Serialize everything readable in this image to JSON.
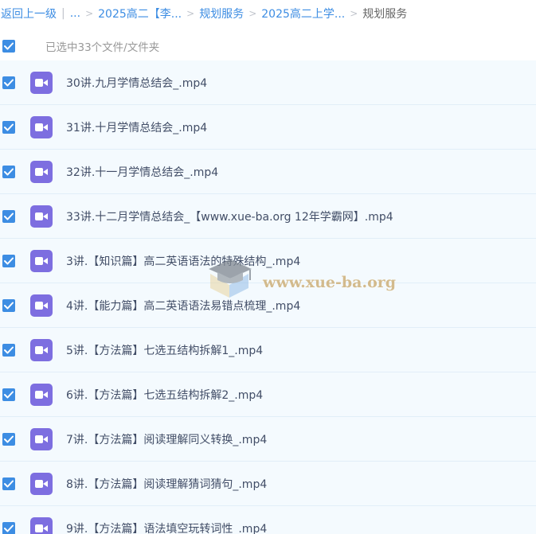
{
  "breadcrumb": {
    "back_label": "返回上一级",
    "divider": "|",
    "ellipsis": "...",
    "sep": ">",
    "items": [
      "2025高二【李...",
      "规划服务",
      "2025高二上学..."
    ],
    "current": "规划服务"
  },
  "selection": {
    "checked": true,
    "text": "已选中33个文件/文件夹"
  },
  "files": [
    {
      "name": "30讲.九月学情总结会_.mp4",
      "checked": true,
      "icon": "video-icon"
    },
    {
      "name": "31讲.十月学情总结会_.mp4",
      "checked": true,
      "icon": "video-icon"
    },
    {
      "name": "32讲.十一月学情总结会_.mp4",
      "checked": true,
      "icon": "video-icon"
    },
    {
      "name": "33讲.十二月学情总结会_【www.xue-ba.org 12年学霸网】.mp4",
      "checked": true,
      "icon": "video-icon"
    },
    {
      "name": "3讲.【知识篇】高二英语语法的特殊结构_.mp4",
      "checked": true,
      "icon": "video-icon"
    },
    {
      "name": "4讲.【能力篇】高二英语语法易错点梳理_.mp4",
      "checked": true,
      "icon": "video-icon"
    },
    {
      "name": "5讲.【方法篇】七选五结构拆解1_.mp4",
      "checked": true,
      "icon": "video-icon"
    },
    {
      "name": "6讲.【方法篇】七选五结构拆解2_.mp4",
      "checked": true,
      "icon": "video-icon"
    },
    {
      "name": "7讲.【方法篇】阅读理解同义转换_.mp4",
      "checked": true,
      "icon": "video-icon"
    },
    {
      "name": "8讲.【方法篇】阅读理解猜词猜句_.mp4",
      "checked": true,
      "icon": "video-icon"
    },
    {
      "name": "9讲.【方法篇】语法填空玩转词性_.mp4",
      "checked": true,
      "icon": "video-icon"
    }
  ],
  "watermark": {
    "text": "www.xue-ba.org",
    "icon": "graduation-cap-icon"
  },
  "colors": {
    "accent": "#3d8de3",
    "video_icon": "#7d6ee0",
    "row_bg": "#f4fafe",
    "row_border": "#e1eef8",
    "file_text": "#424e67",
    "watermark": "#c9a768"
  }
}
